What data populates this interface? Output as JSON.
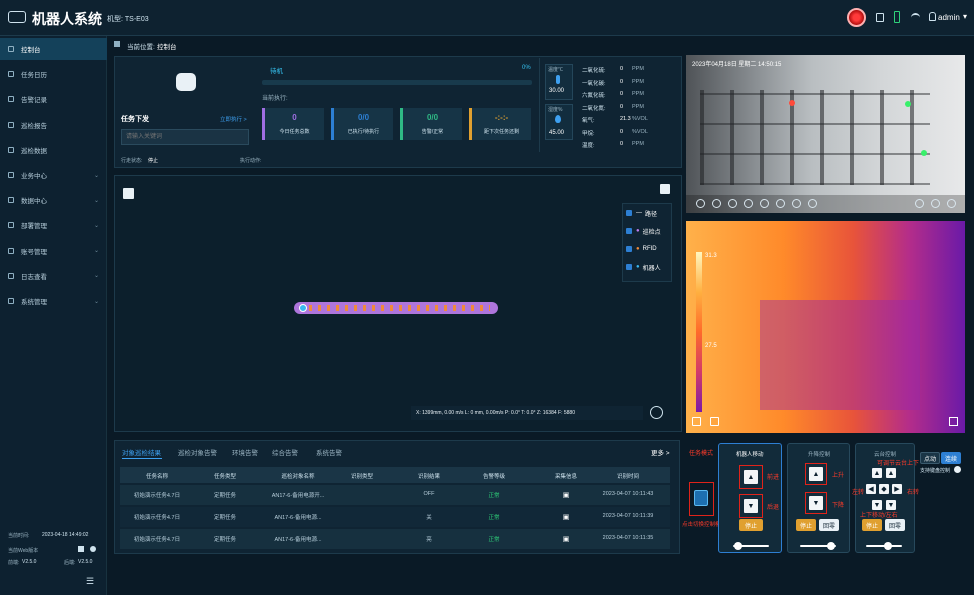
{
  "topbar": {
    "app_title": "机器人系统",
    "robot_label": "机型: TS-E03",
    "user_name": "admin",
    "user_caret": "▾"
  },
  "sidebar": {
    "items": [
      {
        "label": "控制台",
        "active": true,
        "chevron": ""
      },
      {
        "label": "任务日历",
        "active": false,
        "chevron": ""
      },
      {
        "label": "告警记录",
        "active": false,
        "chevron": ""
      },
      {
        "label": "巡检报告",
        "active": false,
        "chevron": ""
      },
      {
        "label": "巡检数据",
        "active": false,
        "chevron": ""
      },
      {
        "label": "业务中心",
        "active": false,
        "chevron": "⌄"
      },
      {
        "label": "数据中心",
        "active": false,
        "chevron": "⌄"
      },
      {
        "label": "部署管理",
        "active": false,
        "chevron": "⌄"
      },
      {
        "label": "账号管理",
        "active": false,
        "chevron": "⌄"
      },
      {
        "label": "日志查看",
        "active": false,
        "chevron": "⌄"
      },
      {
        "label": "系统管理",
        "active": false,
        "chevron": "⌄"
      }
    ],
    "footer": {
      "time_label": "当前时间:",
      "time_value": "2023-04-18 14:49:02",
      "web_version": "当前Web版本",
      "front_label": "前端:",
      "front_version": "V2.5.0",
      "back_label": "后端:",
      "back_version": "V2.5.0",
      "collapse_icon": "☰"
    }
  },
  "breadcrumb": {
    "prefix": "当前位置:",
    "current": "控制台"
  },
  "task_panel": {
    "title": "任务下发",
    "execute_link": "立即执行 >",
    "input_placeholder": "请输入关键词",
    "status_label": "行走状态:",
    "status_value": "停止",
    "exec_label": "执行动作:",
    "exec_value": ""
  },
  "progress": {
    "state": "待机",
    "percent_text": "0%",
    "percent": 0,
    "execute_label": "当前执行:",
    "cards": [
      {
        "value": "0",
        "label": "今日任务总数",
        "color": "#a06ee3"
      },
      {
        "value": "0/0",
        "label": "已执行/待执行",
        "color": "#2d7fd3"
      },
      {
        "value": "0/0",
        "label": "告警/正常",
        "color": "#2fb985"
      },
      {
        "value": "-:-:-",
        "label": "距下次任务还剩",
        "color": "#e0a030"
      }
    ]
  },
  "env": {
    "temp_label": "温度℃",
    "temp_value": "30.00",
    "humidity_label": "湿度%",
    "humidity_value": "45.00",
    "gases": [
      {
        "name": "二氧化硫:",
        "value": "0",
        "unit": "PPM"
      },
      {
        "name": "一氧化碳:",
        "value": "0",
        "unit": "PPM"
      },
      {
        "name": "六氟化硫:",
        "value": "0",
        "unit": "PPM"
      },
      {
        "name": "二氧化氮:",
        "value": "0",
        "unit": "PPM"
      },
      {
        "name": "氧气:",
        "value": "21.3",
        "unit": "%VOL"
      },
      {
        "name": "甲烷:",
        "value": "0",
        "unit": "%VOL"
      },
      {
        "name": "温度:",
        "value": "0",
        "unit": "PPM"
      }
    ]
  },
  "map": {
    "legend": [
      {
        "label": "路径",
        "symbol": "—",
        "color": "#ffffff"
      },
      {
        "label": "巡检点",
        "symbol": "●",
        "color": "#c07ef0"
      },
      {
        "label": "RFID",
        "symbol": "●",
        "color": "#f08a3a"
      },
      {
        "label": "机器人",
        "symbol": "●",
        "color": "#3ab8f0"
      }
    ],
    "status_bar": "X: 1399mm,  0.00 m/s    L: 0 mm,  0.00m/s    P: 0.0°    T: 0.0°    Z: 16384    F: 5880"
  },
  "camera": {
    "timestamp": "2023年04月18日  星期二  14:50:15"
  },
  "thermal": {
    "scale_high": "31.3",
    "scale_mid": "27.5"
  },
  "results": {
    "tabs": [
      "对象巡检结果",
      "巡检对象告警",
      "环境告警",
      "综合告警",
      "系统告警"
    ],
    "more": "更多 >",
    "columns": [
      "任务名称",
      "任务类型",
      "巡检对象名称",
      "识别类型",
      "识别结果",
      "告警等级",
      "采集信息",
      "识别时间"
    ],
    "rows": [
      {
        "name": "初始演示任务4.7日",
        "type": "定期任务",
        "object": "AN17-6-备用电源开...",
        "kind": "",
        "result": "OFF",
        "level": "正常",
        "info": "▣",
        "time": "2023-04-07 10:11:43"
      },
      {
        "name": "初始演示任务4.7日",
        "type": "定期任务",
        "object": "AN17-6-备用电源...",
        "kind": "",
        "result": "关",
        "level": "正常",
        "info": "▣",
        "time": "2023-04-07 10:11:39"
      },
      {
        "name": "初始演示任务4.7日",
        "type": "定期任务",
        "object": "AN17-6-备用电源...",
        "kind": "",
        "result": "亮",
        "level": "正常",
        "info": "▣",
        "time": "2023-04-07 10:11:35"
      }
    ]
  },
  "control": {
    "mode_label": "任务模式",
    "switch_label": "点击切换控制模式",
    "move_title": "机器人移动",
    "forward": "前进",
    "backward": "后退",
    "stop": "停止",
    "lift_title": "升降控制",
    "up": "上升",
    "down": "下降",
    "lift_stop": "停止",
    "lift_reset": "回零",
    "pan_title": "云台控制",
    "pan_up_label": "可调节云台上下",
    "pan_left": "左转",
    "pan_right": "右转",
    "pan_updown": "上下移动/左右",
    "pan_stop": "停止",
    "pan_reset": "回零",
    "btn_point": "点动",
    "btn_continuous": "连续",
    "keyboard_label": "支持键盘控制",
    "move_speed": 0.15,
    "lift_speed": 0.85,
    "pan_speed": 0.6
  }
}
